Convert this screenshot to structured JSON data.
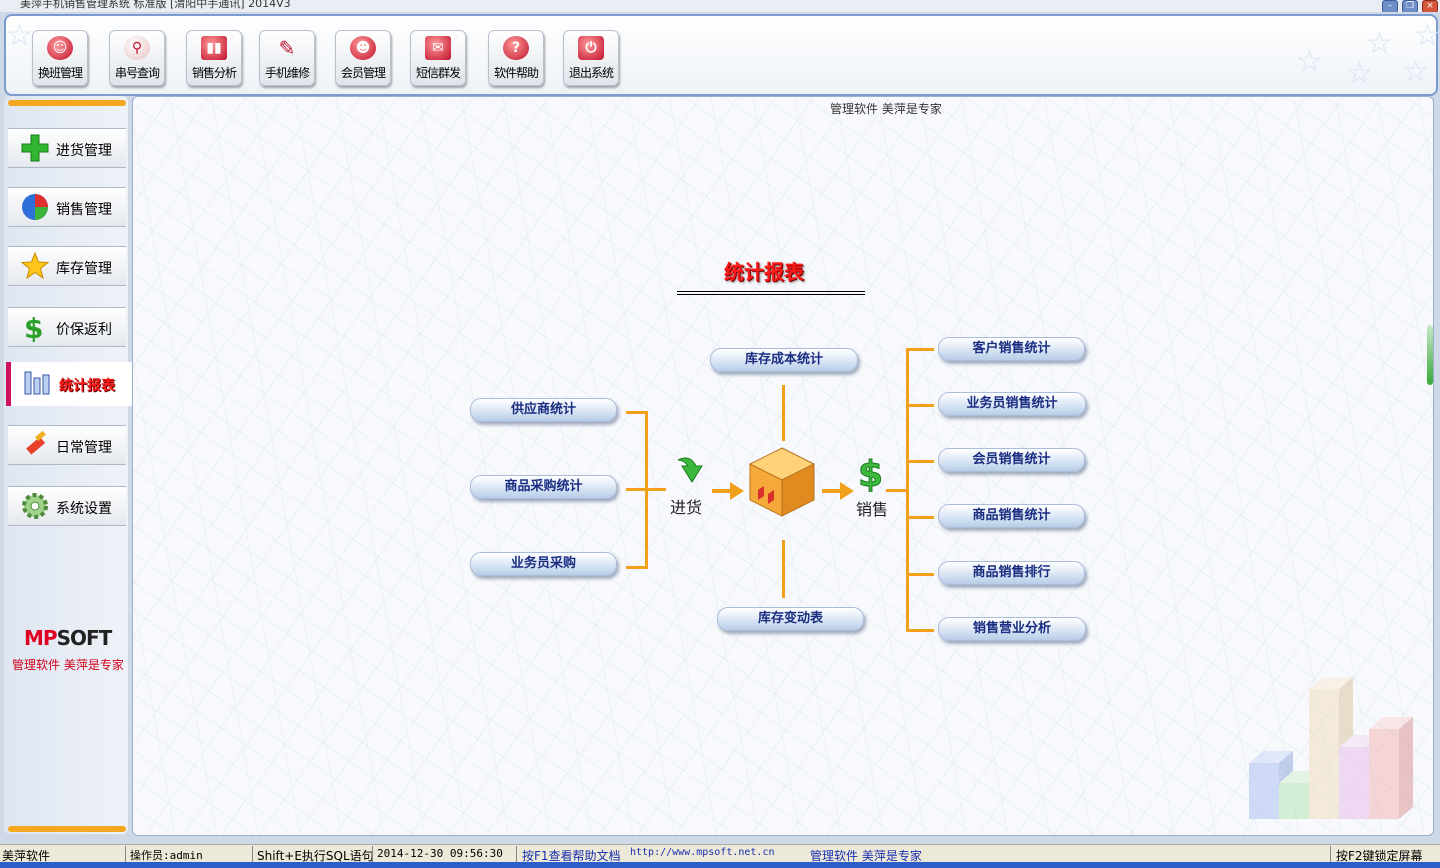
{
  "window": {
    "title": "美萍手机销售管理系统  标准版 [渭阳中手通讯] 2014V3"
  },
  "toolbar": {
    "buttons": [
      {
        "label": "换班管理",
        "icon": "shift-person-icon"
      },
      {
        "label": "串号查询",
        "icon": "magnifier-icon"
      },
      {
        "label": "销售分析",
        "icon": "bar-chart-icon"
      },
      {
        "label": "手机维修",
        "icon": "screwdriver-icon"
      },
      {
        "label": "会员管理",
        "icon": "member-icon"
      },
      {
        "label": "短信群发",
        "icon": "envelope-icon"
      },
      {
        "label": "软件帮助",
        "icon": "help-icon"
      },
      {
        "label": "退出系统",
        "icon": "power-icon"
      }
    ]
  },
  "sidebar": {
    "items": [
      {
        "label": "进货管理",
        "icon": "plus-icon"
      },
      {
        "label": "销售管理",
        "icon": "pie-chart-icon"
      },
      {
        "label": "库存管理",
        "icon": "star-icon"
      },
      {
        "label": "价保返利",
        "icon": "dollar-icon"
      },
      {
        "label": "统计报表",
        "icon": "report-bars-icon",
        "active": true
      },
      {
        "label": "日常管理",
        "icon": "brush-icon"
      },
      {
        "label": "系统设置",
        "icon": "gear-icon"
      }
    ],
    "logo": {
      "brand_red": "MP",
      "brand_dark": "SOFT"
    },
    "slogan": "管理软件  美萍是专家"
  },
  "main": {
    "tagline": "管理软件  美萍是专家",
    "title": "统计报表",
    "purchase_label": "进货",
    "sales_label": "销售",
    "left_items": [
      "供应商统计",
      "商品采购统计",
      "业务员采购"
    ],
    "top_item": "库存成本统计",
    "bottom_item": "库存变动表",
    "right_items": [
      "客户销售统计",
      "业务员销售统计",
      "会员销售统计",
      "商品销售统计",
      "商品销售排行",
      "销售营业分析"
    ]
  },
  "status": {
    "app": "美萍软件",
    "operator": "操作员:admin",
    "sql_hint": "Shift+E执行SQL语句",
    "datetime": "2014-12-30 09:56:30",
    "help_hint": "按F1查看帮助文档",
    "url": "http://www.mpsoft.net.cn",
    "slogan": "管理软件   美萍是专家",
    "lock_hint": "按F2键锁定屏幕"
  },
  "colors": {
    "accent_orange": "#f0a01a",
    "title_red": "#ff1a1a",
    "pill_text": "#1a2d80",
    "brand_red": "#e00020"
  }
}
